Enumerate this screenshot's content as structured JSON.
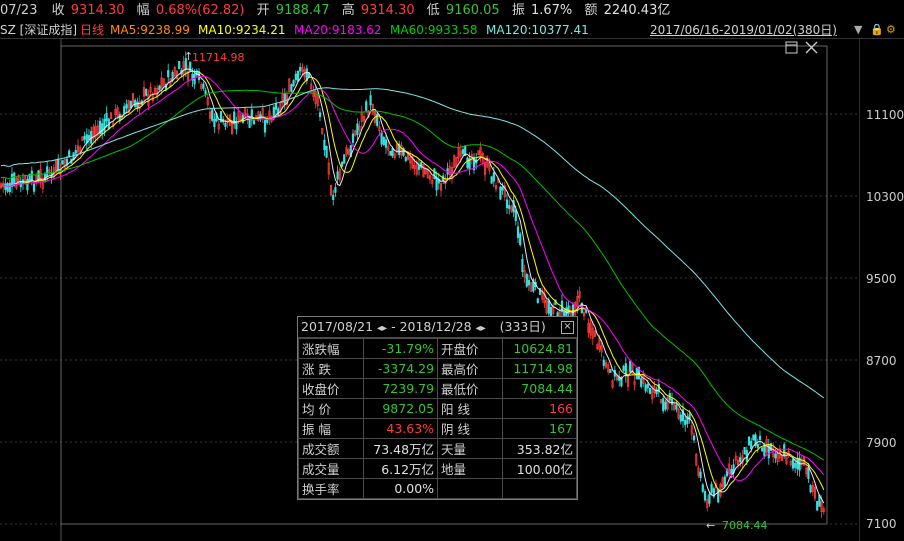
{
  "header": {
    "date": "07/23",
    "close_label": "收",
    "close": "9314.30",
    "range_label": "幅",
    "range": "0.68%(62.82)",
    "open_label": "开",
    "open": "9188.47",
    "high_label": "高",
    "high": "9314.30",
    "low_label": "低",
    "low": "9160.05",
    "amp_label": "振",
    "amp": "1.67%",
    "amount_label": "额",
    "amount": "2240.43亿"
  },
  "ma_bar": {
    "symbol": "SZ [深证成指]",
    "period": "日线",
    "ma5": "MA5:9238.99",
    "ma10": "MA10:9234.21",
    "ma20": "MA20:9183.62",
    "ma60": "MA60:9933.58",
    "ma120": "MA120:10377.41",
    "date_range": "2017/06/16-2019/01/02(380日)"
  },
  "colors": {
    "up": "#ff3b3b",
    "down": "#36c236",
    "ma5": "#e8e8e8",
    "ma10": "#ffff00",
    "ma20": "#ff00ff",
    "ma60": "#00c000",
    "ma120": "#7fe5e5",
    "label_orange": "#ff8c00"
  },
  "chart_data": {
    "type": "candlestick",
    "yticks": [
      "11100",
      "10300",
      "9500",
      "8700",
      "7900",
      "7100"
    ],
    "high_marker": "11714.98",
    "low_marker": "7084.44"
  },
  "stats": {
    "from_date": "2017/08/21",
    "to_date": "2018/12/28",
    "days": "(333日)",
    "rows": [
      {
        "k1": "涨跌幅",
        "v1": "-31.79%",
        "c1": "green",
        "k2": "开盘价",
        "v2": "10624.81",
        "c2": "green"
      },
      {
        "k1": "涨  跌",
        "v1": "-3374.29",
        "c1": "green",
        "k2": "最高价",
        "v2": "11714.98",
        "c2": "green"
      },
      {
        "k1": "收盘价",
        "v1": "7239.79",
        "c1": "green",
        "k2": "最低价",
        "v2": "7084.44",
        "c2": "green"
      },
      {
        "k1": "均  价",
        "v1": "9872.05",
        "c1": "green",
        "k2": "阳  线",
        "v2": "166",
        "c2": "red"
      },
      {
        "k1": "振  幅",
        "v1": "43.63%",
        "c1": "red",
        "k2": "阴  线",
        "v2": "167",
        "c2": "green"
      },
      {
        "k1": "成交额",
        "v1": "73.48万亿",
        "c1": "white",
        "k2": "天量",
        "v2": "353.82亿",
        "c2": "white"
      },
      {
        "k1": "成交量",
        "v1": "6.12万亿",
        "c1": "white",
        "k2": "地量",
        "v2": "100.00亿",
        "c2": "white"
      },
      {
        "k1": "换手率",
        "v1": "0.00%",
        "c1": "white",
        "k2": "",
        "v2": "",
        "c2": "white"
      }
    ]
  }
}
